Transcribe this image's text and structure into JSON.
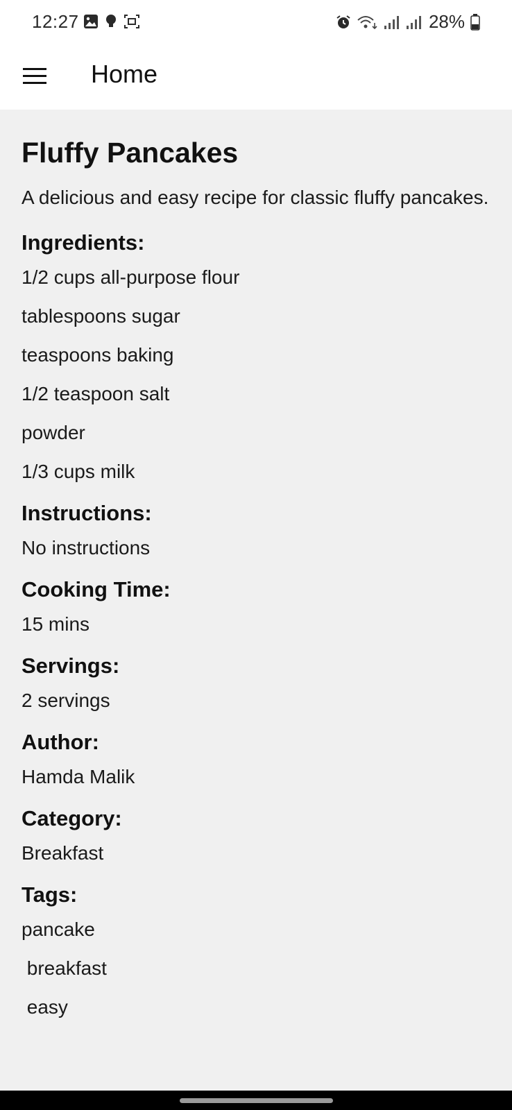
{
  "status_bar": {
    "time": "12:27",
    "battery": "28%",
    "left_icons": [
      "gallery-icon",
      "bulb-icon",
      "screenshot-icon"
    ],
    "right_icons": [
      "alarm-icon",
      "wifi-icon",
      "signal-icon",
      "signal-icon",
      "battery-icon"
    ]
  },
  "app_bar": {
    "title": "Home",
    "menu_icon": "hamburger-menu-icon"
  },
  "recipe": {
    "title": "Fluffy Pancakes",
    "description": "A delicious and easy recipe for classic fluffy pancakes.",
    "ingredients_heading": "Ingredients:",
    "ingredients": [
      "1/2 cups all-purpose flour",
      "tablespoons sugar",
      "teaspoons baking",
      "1/2 teaspoon salt",
      "powder",
      "1/3 cups milk"
    ],
    "instructions_heading": "Instructions:",
    "instructions": "No instructions",
    "cooking_time_heading": "Cooking Time:",
    "cooking_time": "15 mins",
    "servings_heading": "Servings:",
    "servings": "2 servings",
    "author_heading": "Author:",
    "author": "Hamda Malik",
    "category_heading": "Category:",
    "category": "Breakfast",
    "tags_heading": "Tags:",
    "tags": [
      "pancake",
      " breakfast",
      " easy"
    ]
  },
  "colors": {
    "background": "#f0f0f0",
    "app_bar": "#ffffff",
    "text": "#111111",
    "nav_bar": "#000000"
  }
}
